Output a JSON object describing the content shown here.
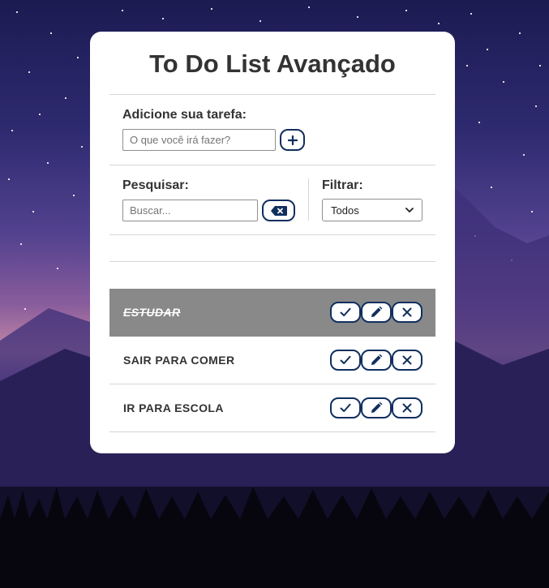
{
  "app": {
    "title": "To Do List Avançado"
  },
  "add_form": {
    "label": "Adicione sua tarefa:",
    "placeholder": "O que você irá fazer?",
    "value": "",
    "add_icon": "plus-icon"
  },
  "search": {
    "label": "Pesquisar:",
    "placeholder": "Buscar...",
    "value": "",
    "clear_icon": "backspace-icon"
  },
  "filter": {
    "label": "Filtrar:",
    "selected": "Todos",
    "options": [
      "Todos"
    ]
  },
  "todos": [
    {
      "text": "ESTUDAR",
      "done": true
    },
    {
      "text": "SAIR PARA COMER",
      "done": false
    },
    {
      "text": "IR PARA ESCOLA",
      "done": false
    }
  ],
  "todo_action_icons": [
    "check-icon",
    "pencil-icon",
    "close-icon"
  ],
  "colors": {
    "accent": "#102f5e",
    "done_row": "#898989",
    "card": "#ffffff"
  }
}
